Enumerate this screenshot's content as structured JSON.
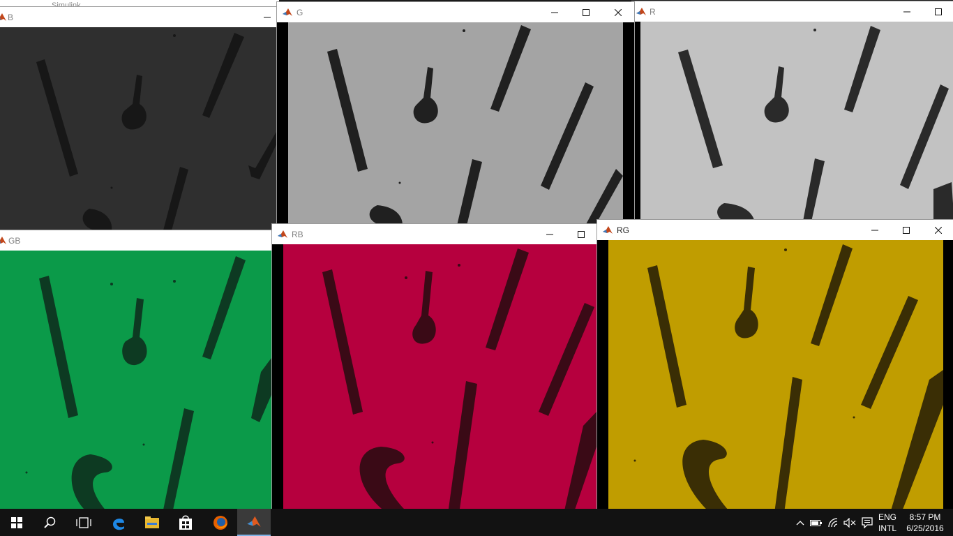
{
  "background_window": {
    "title": "Simulink"
  },
  "windows": [
    {
      "id": "B",
      "title": "B",
      "tint": "#2f2f2f"
    },
    {
      "id": "G",
      "title": "G",
      "tint": "#a4a4a4"
    },
    {
      "id": "R",
      "title": "R",
      "tint": "#c2c2c2"
    },
    {
      "id": "GB",
      "title": "GB",
      "tint": "#0b9a49"
    },
    {
      "id": "RB",
      "title": "RB",
      "tint": "#b6003e"
    },
    {
      "id": "RG",
      "title": "RG",
      "tint": "#c09d00"
    }
  ],
  "window_controls": {
    "minimize": "minimize-icon",
    "maximize": "maximize-icon",
    "close": "close-icon"
  },
  "taskbar": {
    "items": [
      "start-icon",
      "search-icon",
      "task-view-icon",
      "edge-icon",
      "file-explorer-icon",
      "store-icon",
      "firefox-icon",
      "matlab-icon"
    ],
    "tray": {
      "icons": [
        "chevron-up-icon",
        "battery-icon",
        "wifi-icon",
        "volume-muted-icon",
        "action-center-icon"
      ],
      "lang_line1": "ENG",
      "lang_line2": "INTL",
      "time": "8:57 PM",
      "date": "6/25/2016"
    }
  }
}
